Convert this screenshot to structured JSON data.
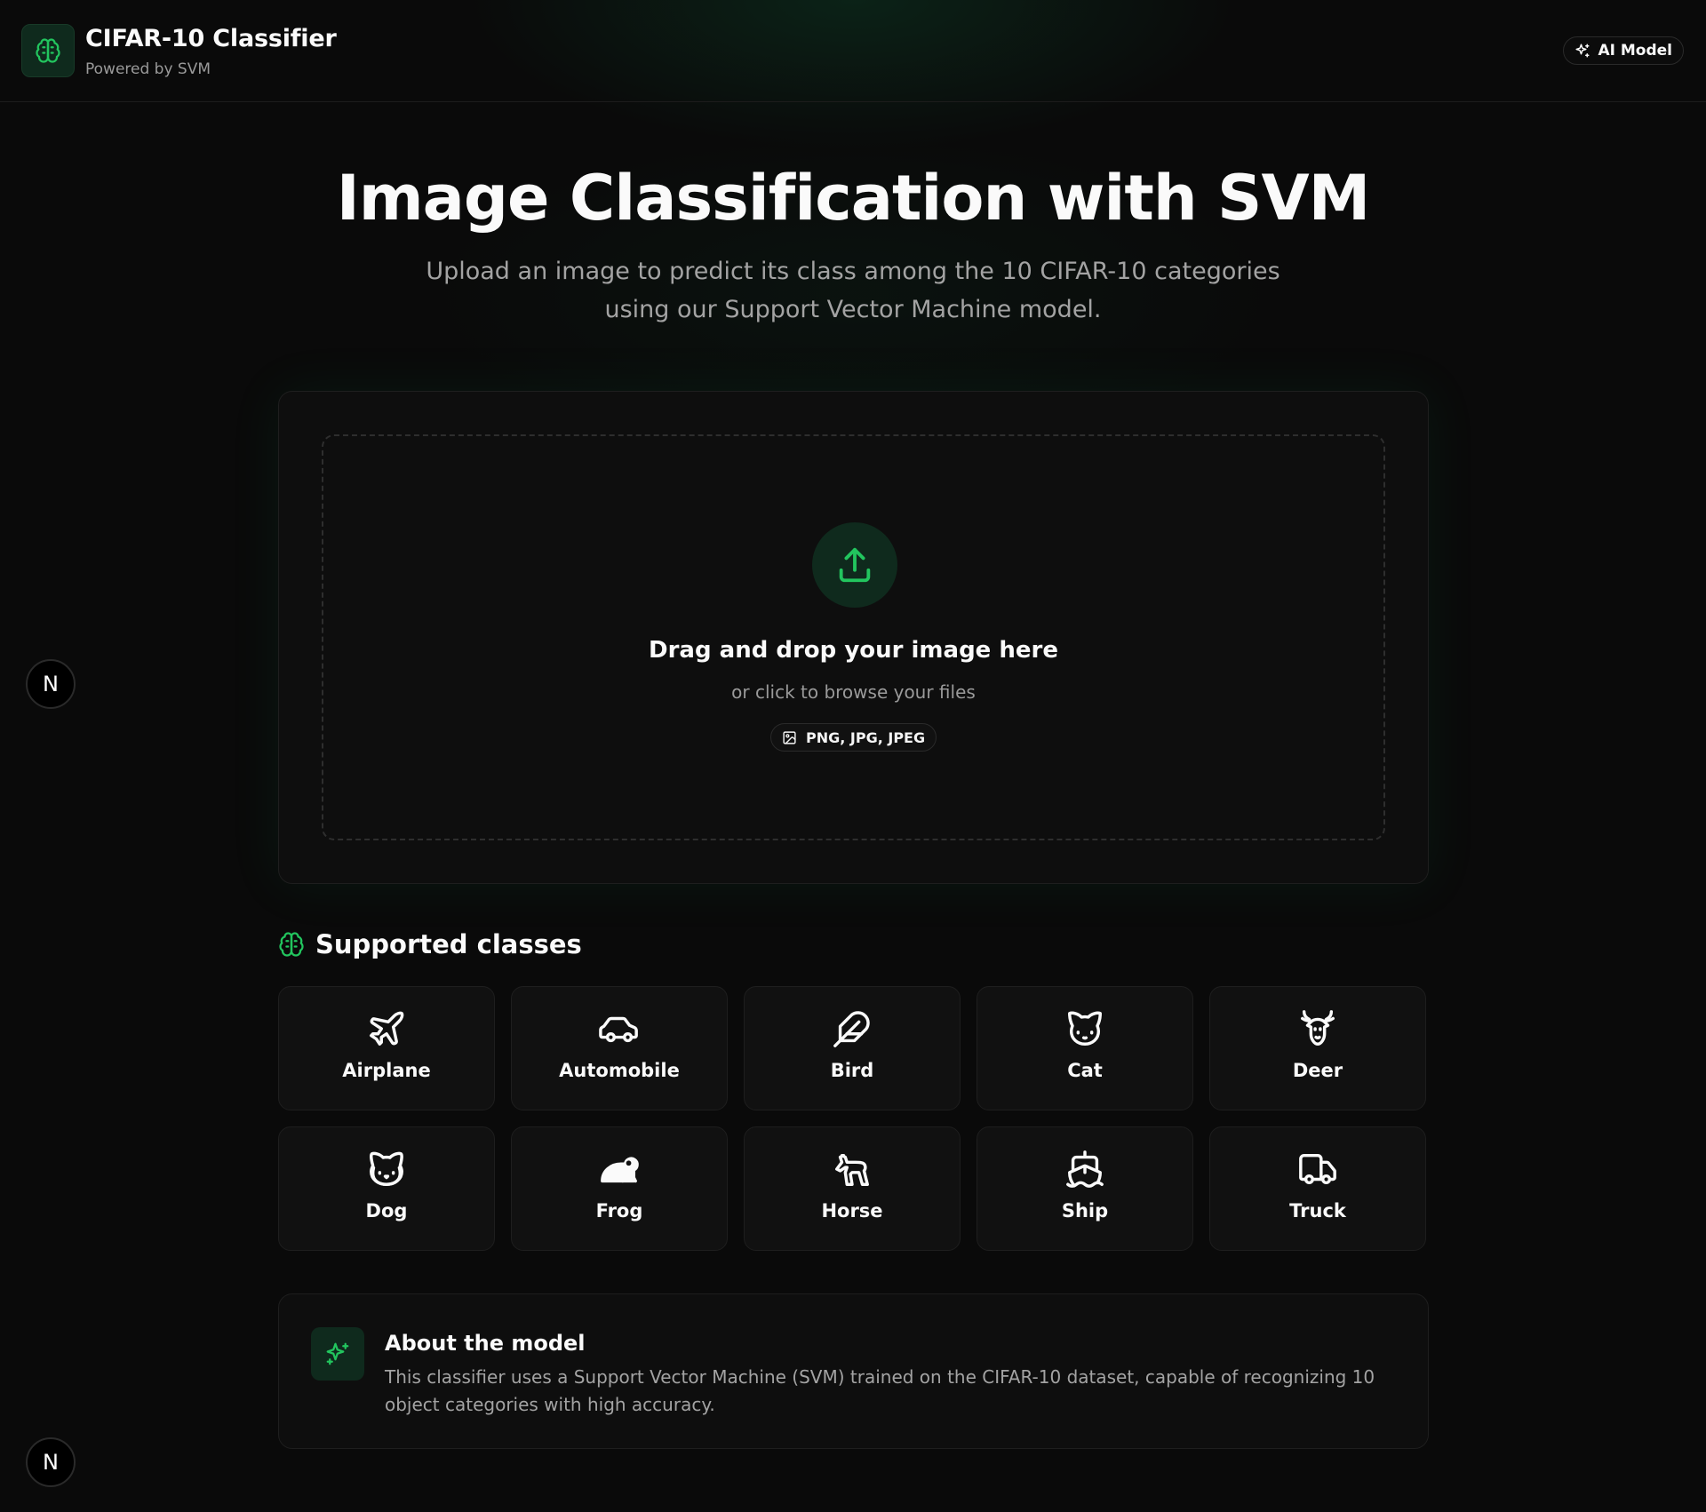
{
  "header": {
    "title": "CIFAR-10 Classifier",
    "subtitle": "Powered by SVM",
    "badge_label": "AI Model"
  },
  "hero": {
    "title": "Image Classification with SVM",
    "subtitle": "Upload an image to predict its class among the 10 CIFAR-10 categories using our Support Vector Machine model."
  },
  "upload": {
    "title": "Drag and drop your image here",
    "subtitle": "or click to browse your files",
    "formats": "PNG, JPG, JPEG"
  },
  "classes": {
    "title": "Supported classes",
    "items": [
      {
        "label": "Airplane",
        "icon": "airplane-icon"
      },
      {
        "label": "Automobile",
        "icon": "car-icon"
      },
      {
        "label": "Bird",
        "icon": "feather-icon"
      },
      {
        "label": "Cat",
        "icon": "cat-icon"
      },
      {
        "label": "Deer",
        "icon": "deer-icon"
      },
      {
        "label": "Dog",
        "icon": "dog-icon"
      },
      {
        "label": "Frog",
        "icon": "frog-icon"
      },
      {
        "label": "Horse",
        "icon": "horse-icon"
      },
      {
        "label": "Ship",
        "icon": "ship-icon"
      },
      {
        "label": "Truck",
        "icon": "truck-icon"
      }
    ]
  },
  "about": {
    "title": "About the model",
    "text": "This classifier uses a Support Vector Machine (SVM) trained on the CIFAR-10 dataset, capable of recognizing 10 object categories with high accuracy."
  },
  "floating": {
    "label": "N"
  },
  "colors": {
    "accent": "#22c55e",
    "background": "#0a0a0a",
    "card": "#111111"
  }
}
